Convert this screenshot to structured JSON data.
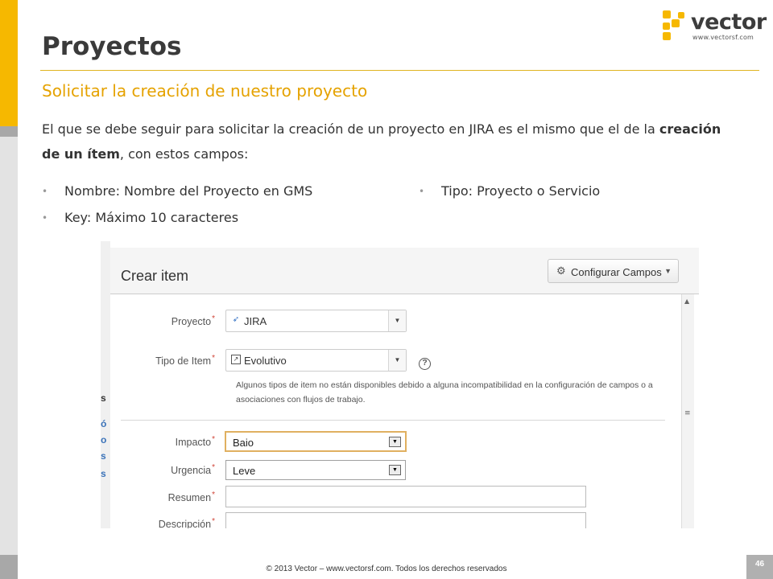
{
  "logo": {
    "word": "vector",
    "url": "www.vectorsf.com"
  },
  "slide": {
    "title": "Proyectos",
    "subtitle": "Solicitar la creación de nuestro proyecto",
    "para_part1": "El que se debe seguir para solicitar la creación de un proyecto en JIRA es el mismo que el de la ",
    "para_bold": "creación de un ítem",
    "para_part2": ", con estos campos:",
    "bullets_left": [
      "Nombre: Nombre del Proyecto en GMS",
      "Key: Máximo 10 caracteres"
    ],
    "bullets_right": [
      "Tipo: Proyecto o Servicio"
    ]
  },
  "dialog": {
    "title": "Crear item",
    "configure_label": "Configurar Campos",
    "fields": {
      "proyecto": {
        "label": "Proyecto",
        "value": "JIRA"
      },
      "tipo": {
        "label": "Tipo de Item",
        "value": "Evolutivo"
      },
      "tipo_note": "Algunos tipos de item no están disponibles debido a alguna incompatibilidad en la configuración de campos o a asociaciones con flujos de trabajo.",
      "impacto": {
        "label": "Impacto",
        "value": "Baio"
      },
      "urgencia": {
        "label": "Urgencia",
        "value": "Leve"
      },
      "resumen": {
        "label": "Resumen"
      },
      "descripcion": {
        "label": "Descripción"
      }
    },
    "required_mark": "*"
  },
  "footer": {
    "text": "© 2013 Vector – www.vectorsf.com. Todos los derechos reservados",
    "page": "46"
  },
  "colors": {
    "accent": "#f6b800",
    "subtitle": "#e5a200",
    "required": "#d04437"
  }
}
